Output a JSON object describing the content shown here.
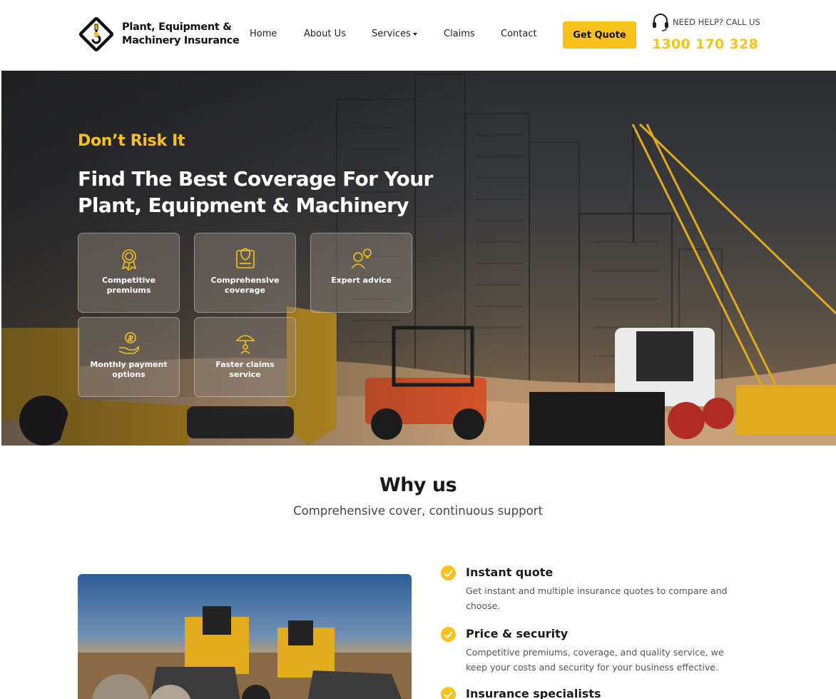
{
  "header": {
    "logo_line1": "Plant, Equipment &",
    "logo_line2": "Machinery Insurance",
    "nav": [
      {
        "label": "Home"
      },
      {
        "label": "About Us"
      },
      {
        "label": "Services"
      },
      {
        "label": "Claims"
      },
      {
        "label": "Contact"
      }
    ],
    "cta_label": "Get Quote",
    "help_text": "NEED HELP? CALL US",
    "phone": "1300 170 328"
  },
  "hero": {
    "tagline": "Don’t Risk It",
    "headline_line1": "Find The Best Coverage For Your",
    "headline_line2": "Plant, Equipment & Machinery",
    "cards": [
      {
        "label": "Competitive premiums",
        "icon": "award-ribbon-icon"
      },
      {
        "label": "Comprehensive coverage",
        "icon": "document-shield-icon"
      },
      {
        "label": "Expert advice",
        "icon": "advisor-lightbulb-icon"
      },
      {
        "label": "Monthly payment options",
        "icon": "hand-coin-icon"
      },
      {
        "label": "Faster claims service",
        "icon": "umbrella-people-icon"
      }
    ]
  },
  "why": {
    "title": "Why us",
    "subtitle": "Comprehensive cover, continuous support",
    "features": [
      {
        "title": "Instant quote",
        "desc_line1": "Get instant and multiple insurance quotes to compare and",
        "desc_line2": "choose."
      },
      {
        "title": "Price & security",
        "desc_line1": "Competitive premiums, coverage, and quality service, we",
        "desc_line2": "keep your costs and security for your business effective."
      },
      {
        "title": "Insurance specialists",
        "desc_line1": "",
        "desc_line2": ""
      }
    ]
  },
  "colors": {
    "accent": "#f9c21b",
    "text": "#1b1b1b",
    "muted": "#555555"
  }
}
